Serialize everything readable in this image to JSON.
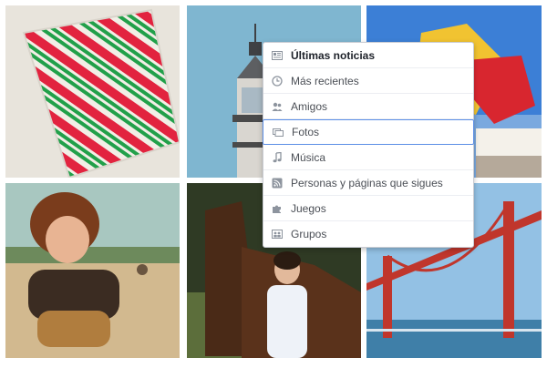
{
  "menu": {
    "items": [
      {
        "label": "Últimas noticias",
        "icon": "news-feed-icon",
        "bold": true
      },
      {
        "label": "Más recientes",
        "icon": "clock-icon"
      },
      {
        "label": "Amigos",
        "icon": "friends-icon"
      },
      {
        "label": "Fotos",
        "icon": "photos-icon",
        "selected": true
      },
      {
        "label": "Música",
        "icon": "music-note-icon"
      },
      {
        "label": "Personas y páginas que sigues",
        "icon": "rss-feed-icon"
      },
      {
        "label": "Juegos",
        "icon": "puzzle-piece-icon"
      },
      {
        "label": "Grupos",
        "icon": "groups-icon"
      }
    ]
  },
  "photos": [
    {
      "subject": "striped-art-print"
    },
    {
      "subject": "lighthouse"
    },
    {
      "subject": "colorful-sign"
    },
    {
      "subject": "child-on-beach"
    },
    {
      "subject": "woman-with-horse"
    },
    {
      "subject": "golden-gate-bridge"
    }
  ],
  "colors": {
    "menu_border": "#c9ccd3",
    "selected_border": "#5b8ee6",
    "text": "#4b4f56",
    "icon": "#8d949e"
  }
}
